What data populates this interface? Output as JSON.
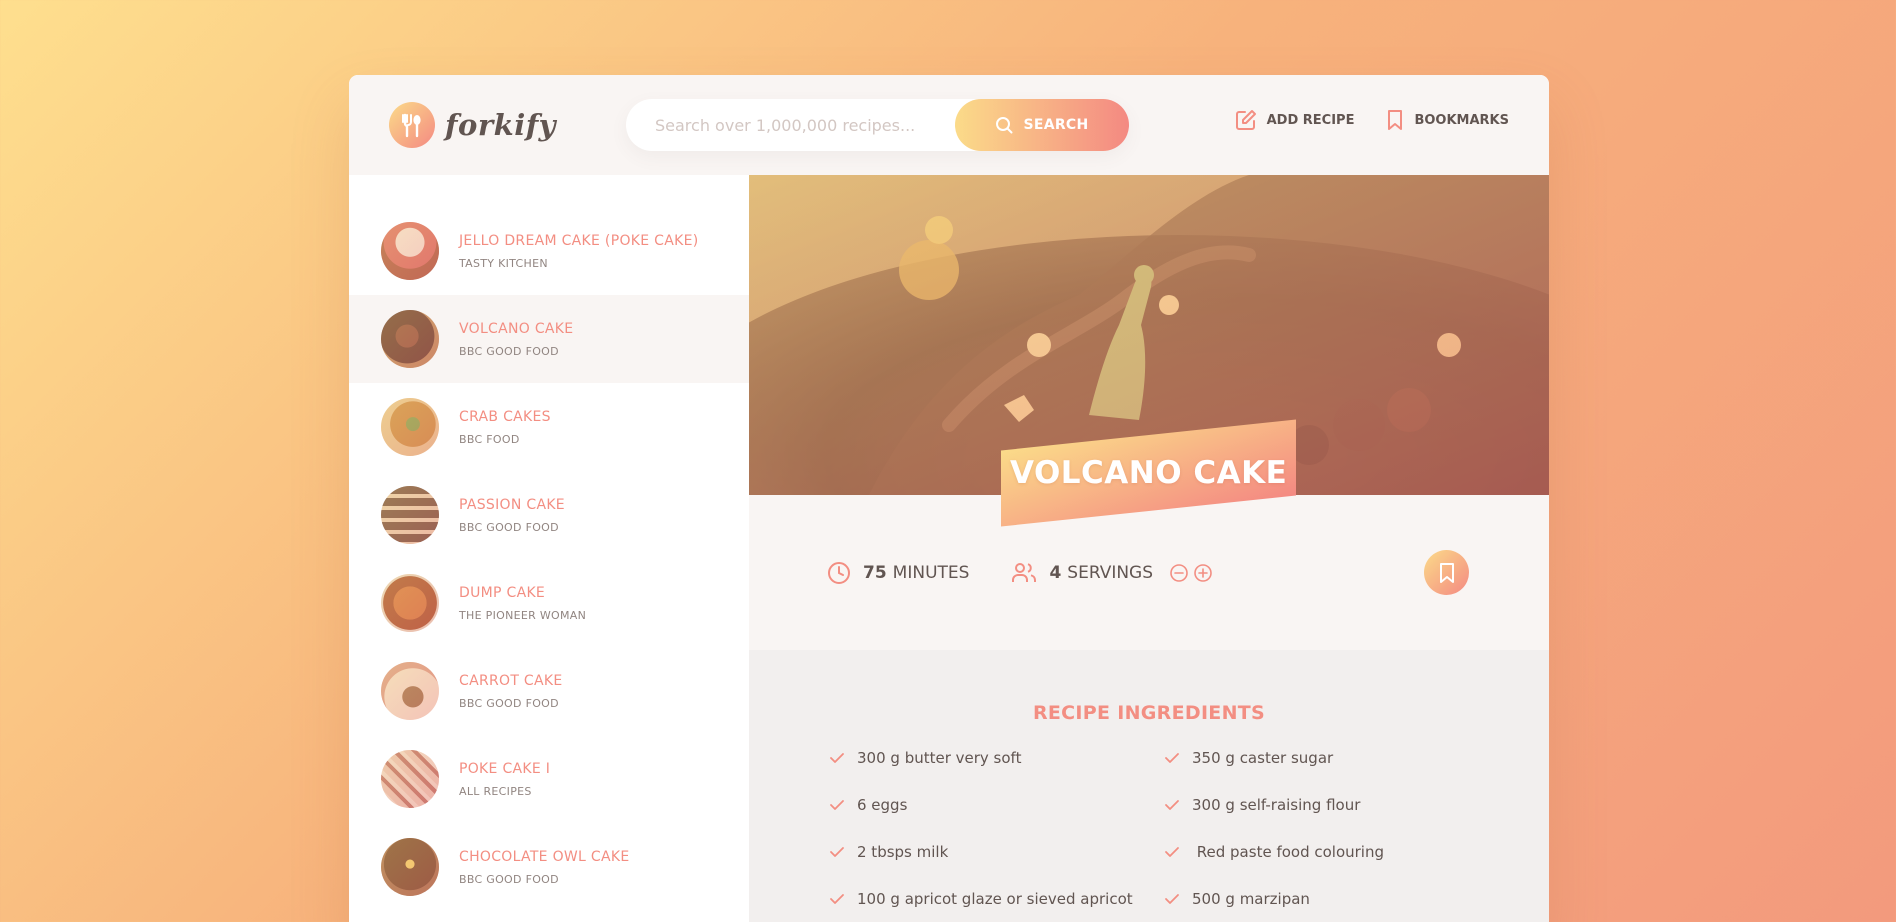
{
  "colors": {
    "accent": "#f38e82",
    "grad_start": "#fbdb89",
    "grad_end": "#f48982",
    "text": "#615551"
  },
  "header": {
    "logo_text": "forkify",
    "search_placeholder": "Search over 1,000,000 recipes...",
    "search_button": "SEARCH",
    "nav": {
      "add_recipe": "ADD RECIPE",
      "bookmarks": "BOOKMARKS"
    }
  },
  "results": [
    {
      "title": "JELLO DREAM CAKE (POKE CAKE)",
      "publisher": "TASTY KITCHEN",
      "active": false
    },
    {
      "title": "VOLCANO CAKE",
      "publisher": "BBC GOOD FOOD",
      "active": true
    },
    {
      "title": "CRAB CAKES",
      "publisher": "BBC FOOD",
      "active": false
    },
    {
      "title": "PASSION CAKE",
      "publisher": "BBC GOOD FOOD",
      "active": false
    },
    {
      "title": "DUMP CAKE",
      "publisher": "THE PIONEER WOMAN",
      "active": false
    },
    {
      "title": "CARROT CAKE",
      "publisher": "BBC GOOD FOOD",
      "active": false
    },
    {
      "title": "POKE CAKE I",
      "publisher": "ALL RECIPES",
      "active": false
    },
    {
      "title": "CHOCOLATE OWL CAKE",
      "publisher": "BBC GOOD FOOD",
      "active": false
    }
  ],
  "recipe": {
    "title": "VOLCANO CAKE",
    "minutes": "75",
    "minutes_label": "MINUTES",
    "servings": "4",
    "servings_label": "SERVINGS",
    "ingredients_heading": "RECIPE INGREDIENTS",
    "ingredients": [
      "300 g butter very soft",
      "350 g caster sugar",
      "6 eggs",
      "300 g self-raising flour",
      "2 tbsps milk",
      " Red paste food colouring",
      "100 g apricot glaze or sieved apricot",
      "500 g marzipan"
    ]
  }
}
